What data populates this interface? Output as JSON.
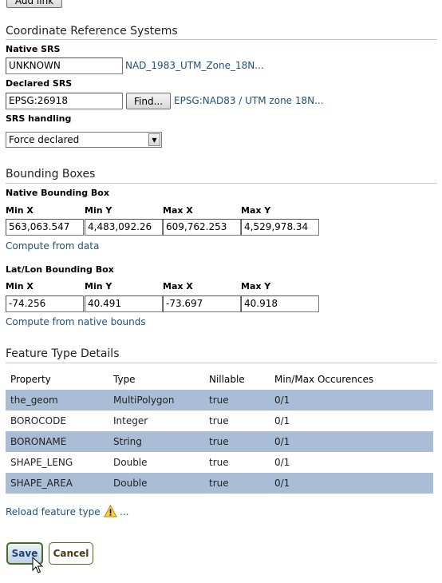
{
  "top": {
    "add_link_label": "Add link"
  },
  "crs": {
    "title": "Coordinate Reference Systems",
    "native_label": "Native SRS",
    "native_value": "UNKNOWN",
    "native_link": "NAD_1983_UTM_Zone_18N...",
    "declared_label": "Declared SRS",
    "declared_value": "EPSG:26918",
    "find_label": "Find...",
    "declared_link": "EPSG:NAD83 / UTM zone 18N...",
    "handling_label": "SRS handling",
    "handling_value": "Force declared"
  },
  "bbox": {
    "title": "Bounding Boxes",
    "native_title": "Native Bounding Box",
    "native_headers": [
      "Min X",
      "Min Y",
      "Max X",
      "Max Y"
    ],
    "native_values": [
      "563,063.547",
      "4,483,092.26",
      "609,762.253",
      "4,529,978.34"
    ],
    "compute_data": "Compute from data",
    "latlon_title": "Lat/Lon Bounding Box",
    "latlon_headers": [
      "Min X",
      "Min Y",
      "Max X",
      "Max Y"
    ],
    "latlon_values": [
      "-74.256",
      "40.491",
      "-73.697",
      "40.918"
    ],
    "compute_native": "Compute from native bounds"
  },
  "features": {
    "title": "Feature Type Details",
    "headers": [
      "Property",
      "Type",
      "Nillable",
      "Min/Max Occurences"
    ],
    "rows": [
      [
        "the_geom",
        "MultiPolygon",
        "true",
        "0/1"
      ],
      [
        "BOROCODE",
        "Integer",
        "true",
        "0/1"
      ],
      [
        "BORONAME",
        "String",
        "true",
        "0/1"
      ],
      [
        "SHAPE_LENG",
        "Double",
        "true",
        "0/1"
      ],
      [
        "SHAPE_AREA",
        "Double",
        "true",
        "0/1"
      ]
    ],
    "reload_label": "Reload feature type",
    "warning_icon": "warning-icon",
    "warning_more": "..."
  },
  "actions": {
    "save_label": "Save",
    "cancel_label": "Cancel"
  },
  "colors": {
    "link": "#1f4f7f",
    "row_alt": "#a9bed6",
    "rule": "#b9cfe0"
  }
}
